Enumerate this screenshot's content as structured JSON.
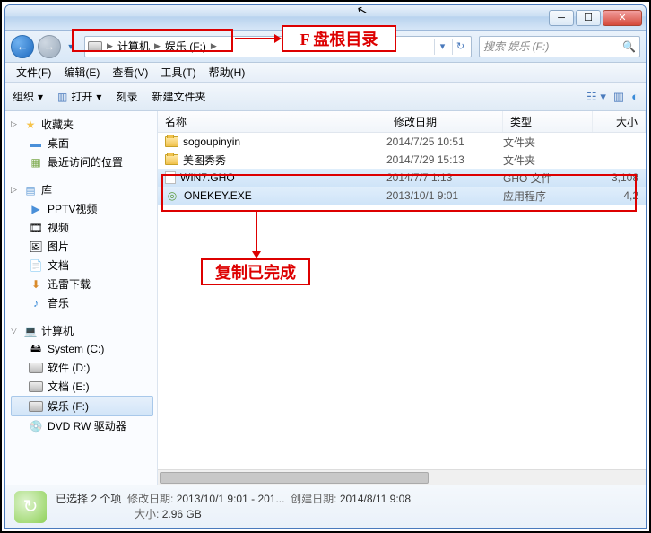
{
  "breadcrumb": {
    "root_icon": "computer",
    "parts": [
      "计算机",
      "娱乐 (F:)"
    ]
  },
  "search": {
    "placeholder": "搜索 娱乐 (F:)"
  },
  "menus": [
    "文件(F)",
    "编辑(E)",
    "查看(V)",
    "工具(T)",
    "帮助(H)"
  ],
  "toolbar": {
    "org": "组织",
    "open": "打开",
    "burn": "刻录",
    "newfolder": "新建文件夹"
  },
  "sidebar": {
    "favorites": {
      "label": "收藏夹",
      "items": [
        {
          "icon": "desktop",
          "label": "桌面"
        },
        {
          "icon": "recent",
          "label": "最近访问的位置"
        }
      ]
    },
    "libraries": {
      "label": "库",
      "items": [
        {
          "icon": "video",
          "label": "PPTV视频"
        },
        {
          "icon": "video",
          "label": "视频"
        },
        {
          "icon": "picture",
          "label": "图片"
        },
        {
          "icon": "document",
          "label": "文档"
        },
        {
          "icon": "download",
          "label": "迅雷下载"
        },
        {
          "icon": "music",
          "label": "音乐"
        }
      ]
    },
    "computer": {
      "label": "计算机",
      "items": [
        {
          "icon": "sysdrive",
          "label": "System (C:)"
        },
        {
          "icon": "drive",
          "label": "软件 (D:)"
        },
        {
          "icon": "drive",
          "label": "文档 (E:)"
        },
        {
          "icon": "drive",
          "label": "娱乐 (F:)",
          "selected": true
        },
        {
          "icon": "dvd",
          "label": "DVD RW 驱动器"
        }
      ]
    }
  },
  "columns": {
    "name": "名称",
    "date": "修改日期",
    "type": "类型",
    "size": "大小"
  },
  "files": [
    {
      "icon": "folder",
      "name": "sogoupinyin",
      "date": "2014/7/25 10:51",
      "type": "文件夹",
      "size": "",
      "selected": false
    },
    {
      "icon": "folder",
      "name": "美图秀秀",
      "date": "2014/7/29 15:13",
      "type": "文件夹",
      "size": "",
      "selected": false
    },
    {
      "icon": "gho",
      "name": "WIN7.GHO",
      "date": "2014/7/7 1:13",
      "type": "GHO 文件",
      "size": "3,108",
      "selected": true
    },
    {
      "icon": "exe",
      "name": "ONEKEY.EXE",
      "date": "2013/10/1 9:01",
      "type": "应用程序",
      "size": "4,2",
      "selected": true
    }
  ],
  "status": {
    "title": "已选择 2 个项",
    "moddate_label": "修改日期:",
    "moddate": "2013/10/1 9:01 - 201...",
    "createdate_label": "创建日期:",
    "createdate": "2014/8/11 9:08",
    "size_label": "大小:",
    "size": "2.96 GB"
  },
  "annotations": {
    "root_label": "F 盘根目录",
    "copy_done": "复制已完成"
  }
}
